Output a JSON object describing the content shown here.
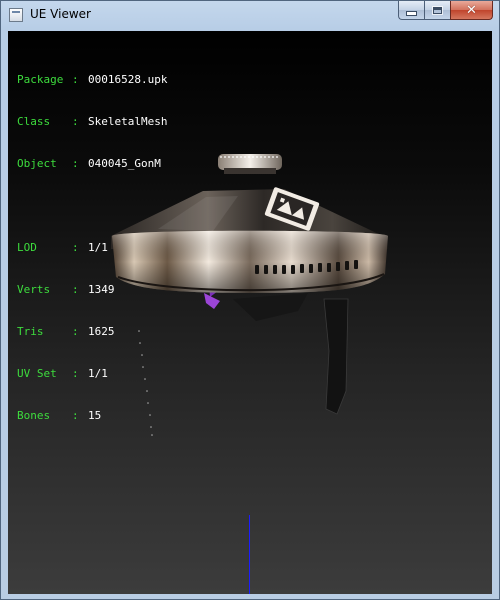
{
  "window": {
    "title": "UE Viewer",
    "buttons": {
      "minimize": "minimize",
      "maximize": "maximize",
      "close": "close"
    },
    "close_glyph": "✕"
  },
  "info": {
    "package": {
      "label": "Package",
      "value": "00016528.upk"
    },
    "class": {
      "label": "Class",
      "value": "SkeletalMesh"
    },
    "object": {
      "label": "Object",
      "value": "040045_GonM"
    },
    "lod": {
      "label": "LOD",
      "value": "1/1"
    },
    "verts": {
      "label": "Verts",
      "value": "1349"
    },
    "tris": {
      "label": "Tris",
      "value": "1625"
    },
    "uvset": {
      "label": "UV Set",
      "value": "1/1"
    },
    "bones": {
      "label": "Bones",
      "value": "15"
    },
    "separator": ":"
  },
  "colors": {
    "label_green": "#3ddc3d",
    "value_white": "#ffffff",
    "axis_blue": "#1c1cff"
  },
  "icons": [
    "app-icon",
    "minimize-icon",
    "maximize-icon",
    "close-icon"
  ]
}
